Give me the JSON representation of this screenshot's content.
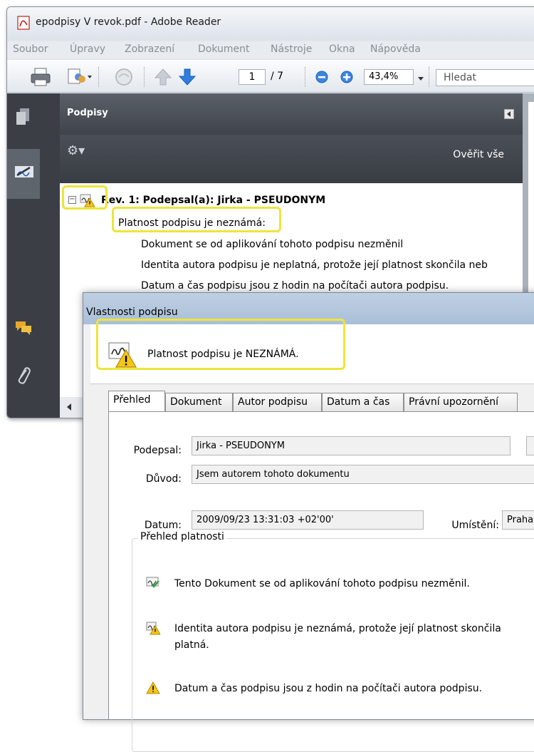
{
  "window": {
    "title": "epodpisy V revok.pdf - Adobe Reader"
  },
  "menu": [
    "Soubor",
    "Úpravy",
    "Zobrazení",
    "Dokument",
    "Nástroje",
    "Okna",
    "Nápověda"
  ],
  "toolbar": {
    "page_current": "1",
    "page_total": "/ 7",
    "zoom": "43,4%",
    "search_placeholder": "Hledat"
  },
  "signatures_panel": {
    "title": "Podpisy",
    "verify_all": "Ověřit vše",
    "revision": "Rev. 1: Podepsal(a): Jirka - PSEUDONYM",
    "validity": "Platnost podpisu je neznámá:",
    "details": [
      "Dokument se od aplikování tohoto podpisu nezměnil",
      "Identita autora podpisu je neplatná, protože její platnost skončila neb",
      "Datum a čas podpisu jsou z hodin na počítači autora podpisu."
    ]
  },
  "dialog": {
    "title": "Vlastnosti podpisu",
    "status": "Platnost podpisu je NEZNÁMÁ.",
    "tabs": [
      "Přehled",
      "Dokument",
      "Autor podpisu",
      "Datum a čas",
      "Právní upozornění"
    ],
    "fields": {
      "signer_label": "Podepsal:",
      "signer_value": "Jirka - PSEUDONYM",
      "reason_label": "Důvod:",
      "reason_value": "Jsem autorem tohoto dokumentu",
      "date_label": "Datum:",
      "date_value": "2009/09/23 13:31:03 +02'00'",
      "location_label": "Umístění:",
      "location_value": "Praha"
    },
    "summary": {
      "title": "Přehled platnosti",
      "items": [
        "Tento Dokument se od aplikování tohoto podpisu nezměnil.",
        "Identita autora podpisu je neznámá, protože její platnost skončila",
        "platná.",
        "Datum a čas podpisu jsou z hodin na počítači autora podpisu."
      ]
    }
  },
  "colors": {
    "highlight": "#ede53a",
    "arrow_blue": "#2f7de1",
    "warning_yellow": "#f5c518"
  }
}
